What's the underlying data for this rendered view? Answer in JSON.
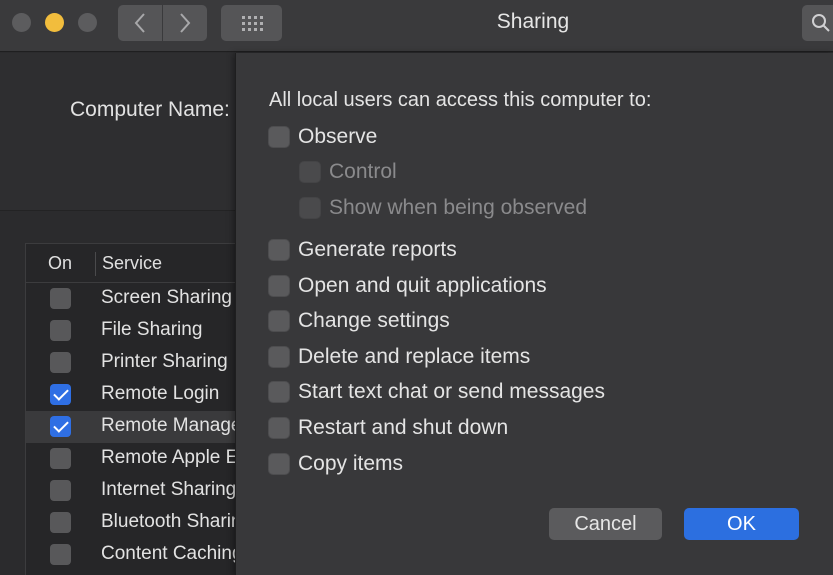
{
  "window": {
    "title": "Sharing"
  },
  "main": {
    "computer_name_label": "Computer Name:"
  },
  "service_list": {
    "header_on": "On",
    "header_service": "Service",
    "rows": [
      {
        "label": "Screen Sharing",
        "on": false
      },
      {
        "label": "File Sharing",
        "on": false
      },
      {
        "label": "Printer Sharing",
        "on": false
      },
      {
        "label": "Remote Login",
        "on": true
      },
      {
        "label": "Remote Management",
        "on": true,
        "selected": true
      },
      {
        "label": "Remote Apple Events",
        "on": false
      },
      {
        "label": "Internet Sharing",
        "on": false
      },
      {
        "label": "Bluetooth Sharing",
        "on": false
      },
      {
        "label": "Content Caching",
        "on": false
      }
    ]
  },
  "sheet": {
    "heading": "All local users can access this computer to:",
    "options": [
      {
        "label": "Observe",
        "checked": false,
        "enabled": true
      },
      {
        "label": "Control",
        "checked": false,
        "enabled": false
      },
      {
        "label": "Show when being observed",
        "checked": false,
        "enabled": false
      },
      {
        "label": "Generate reports",
        "checked": false,
        "enabled": true
      },
      {
        "label": "Open and quit applications",
        "checked": false,
        "enabled": true
      },
      {
        "label": "Change settings",
        "checked": false,
        "enabled": true
      },
      {
        "label": "Delete and replace items",
        "checked": false,
        "enabled": true
      },
      {
        "label": "Start text chat or send messages",
        "checked": false,
        "enabled": true
      },
      {
        "label": "Restart and shut down",
        "checked": false,
        "enabled": true
      },
      {
        "label": "Copy items",
        "checked": false,
        "enabled": true
      }
    ],
    "cancel_label": "Cancel",
    "ok_label": "OK"
  },
  "colors": {
    "accent": "#2c6fe0",
    "minimize": "#f2bd3d"
  }
}
